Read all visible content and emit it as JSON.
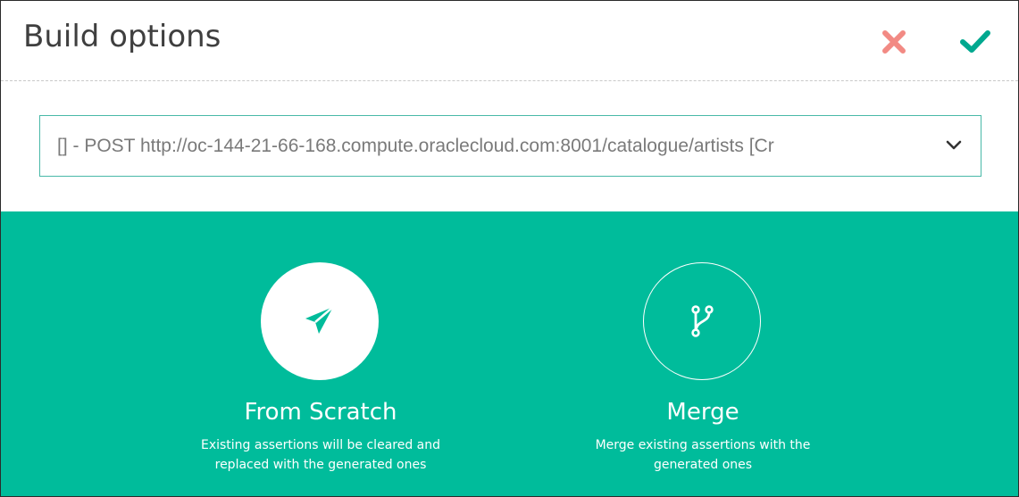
{
  "dialog": {
    "title": "Build options",
    "cancel_icon": "close-icon",
    "confirm_icon": "checkmark-icon"
  },
  "endpoint_select": {
    "value": "[] - POST http://oc-144-21-66-168.compute.oraclecloud.com:8001/catalogue/artists [Cr",
    "icon": "chevron-down-icon"
  },
  "options": {
    "from_scratch": {
      "icon": "paper-plane-icon",
      "title": "From Scratch",
      "description": "Existing assertions will be cleared and replaced with the generated ones"
    },
    "merge": {
      "icon": "branch-merge-icon",
      "title": "Merge",
      "description": "Merge existing assertions with the generated ones"
    }
  },
  "colors": {
    "accent": "#00bc9b",
    "cancel": "#f28a84",
    "confirm": "#00a88f",
    "select_border": "#49b9a8",
    "title_text": "#3f3f3f",
    "select_text": "#7a7a7a"
  }
}
